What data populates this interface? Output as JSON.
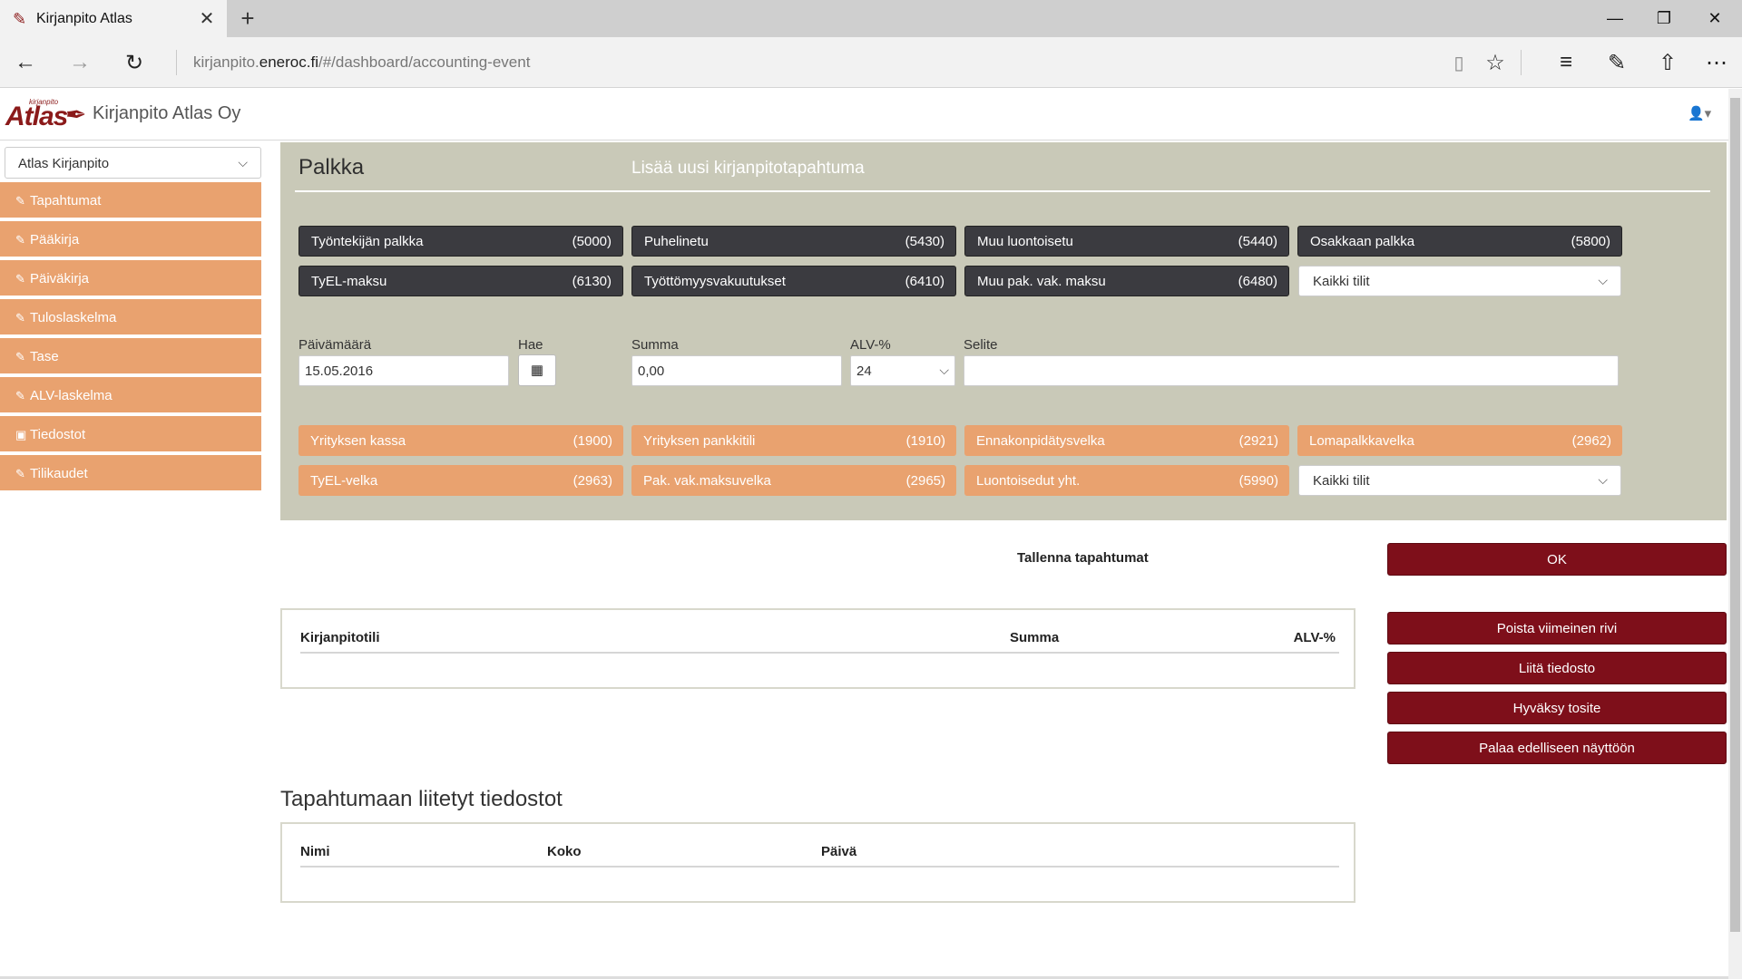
{
  "browser": {
    "tab_title": "Kirjanpito Atlas",
    "url_prefix": "kirjanpito.",
    "url_domain": "eneroc.fi",
    "url_path": "/#/dashboard/accounting-event"
  },
  "app": {
    "logo_small": "kirjanpito",
    "logo_text": "Atlas",
    "company": "Kirjanpito Atlas Oy"
  },
  "sidebar": {
    "select_value": "Atlas Kirjanpito",
    "items": [
      {
        "label": "Tapahtumat"
      },
      {
        "label": "Pääkirja"
      },
      {
        "label": "Päiväkirja"
      },
      {
        "label": "Tuloslaskelma"
      },
      {
        "label": "Tase"
      },
      {
        "label": "ALV-laskelma"
      },
      {
        "label": "Tiedostot"
      },
      {
        "label": "Tilikaudet"
      }
    ]
  },
  "form": {
    "title": "Palkka",
    "subtitle": "Lisää uusi kirjanpitotapahtuma",
    "debit_accounts": [
      {
        "name": "Työntekijän palkka",
        "code": "(5000)"
      },
      {
        "name": "Puhelinetu",
        "code": "(5430)"
      },
      {
        "name": "Muu luontoisetu",
        "code": "(5440)"
      },
      {
        "name": "Osakkaan palkka",
        "code": "(5800)"
      },
      {
        "name": "TyEL-maksu",
        "code": "(6130)"
      },
      {
        "name": "Työttömyysvakuutukset",
        "code": "(6410)"
      },
      {
        "name": "Muu pak. vak. maksu",
        "code": "(6480)"
      }
    ],
    "debit_select": "Kaikki tilit",
    "fields": {
      "date_label": "Päivämäärä",
      "date_value": "15.05.2016",
      "search_label": "Hae",
      "sum_label": "Summa",
      "sum_value": "0,00",
      "vat_label": "ALV-%",
      "vat_value": "24",
      "desc_label": "Selite",
      "desc_value": ""
    },
    "credit_accounts": [
      {
        "name": "Yrityksen kassa",
        "code": "(1900)"
      },
      {
        "name": "Yrityksen pankkitili",
        "code": "(1910)"
      },
      {
        "name": "Ennakonpidätysvelka",
        "code": "(2921)"
      },
      {
        "name": "Lomapalkkavelka",
        "code": "(2962)"
      },
      {
        "name": "TyEL-velka",
        "code": "(2963)"
      },
      {
        "name": "Pak. vak.maksuvelka",
        "code": "(2965)"
      },
      {
        "name": "Luontoisedut yht.",
        "code": "(5990)"
      }
    ],
    "credit_select": "Kaikki tilit"
  },
  "actions": {
    "save_label": "Tallenna tapahtumat",
    "ok": "OK",
    "delete_last": "Poista viimeinen rivi",
    "attach_file": "Liitä tiedosto",
    "approve": "Hyväksy tosite",
    "back": "Palaa edelliseen näyttöön"
  },
  "entries_table": {
    "headers": [
      "Kirjanpitotili",
      "Summa",
      "ALV-%"
    ]
  },
  "files": {
    "title": "Tapahtumaan liitetyt tiedostot",
    "headers": [
      "Nimi",
      "Koko",
      "Päivä"
    ]
  }
}
